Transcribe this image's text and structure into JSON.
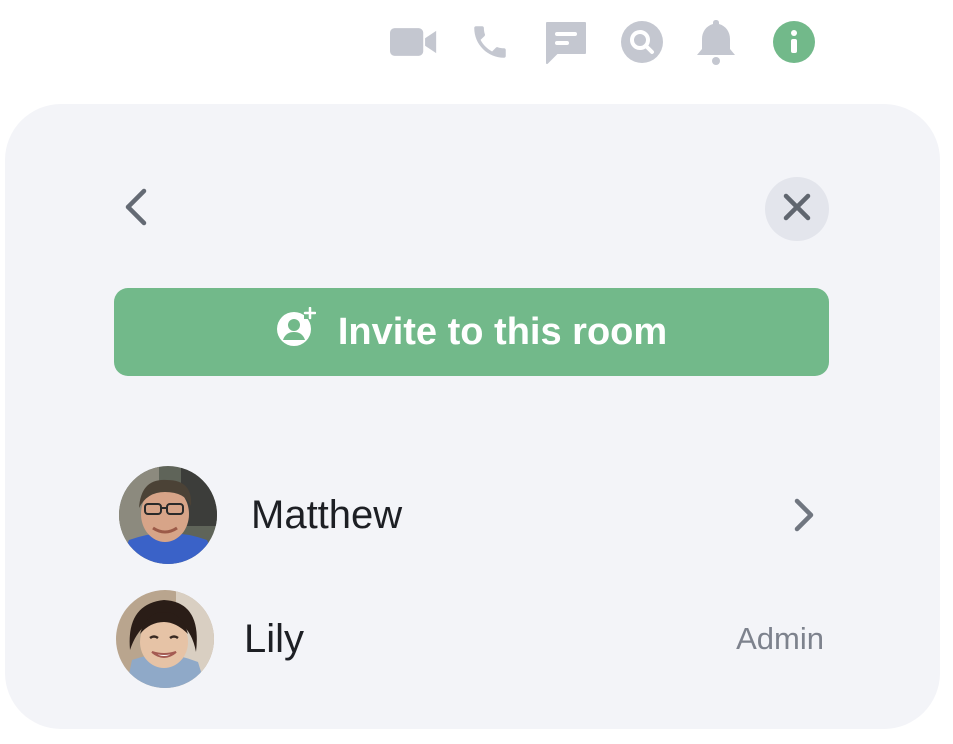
{
  "header": {
    "icons": [
      {
        "name": "video-call-icon",
        "label": "Video call"
      },
      {
        "name": "voice-call-icon",
        "label": "Voice call"
      },
      {
        "name": "threads-icon",
        "label": "Threads"
      },
      {
        "name": "search-icon",
        "label": "Search"
      },
      {
        "name": "notifications-icon",
        "label": "Notifications"
      },
      {
        "name": "room-info-icon",
        "label": "Room info"
      }
    ],
    "icon_color": "#c4c7d0",
    "active_color": "#72b98a"
  },
  "panel": {
    "invite_label": "Invite to this room",
    "accent_color": "#72b98a",
    "members": [
      {
        "name": "Matthew",
        "role": "",
        "has_chevron": true
      },
      {
        "name": "Lily",
        "role": "Admin",
        "has_chevron": false
      }
    ]
  }
}
